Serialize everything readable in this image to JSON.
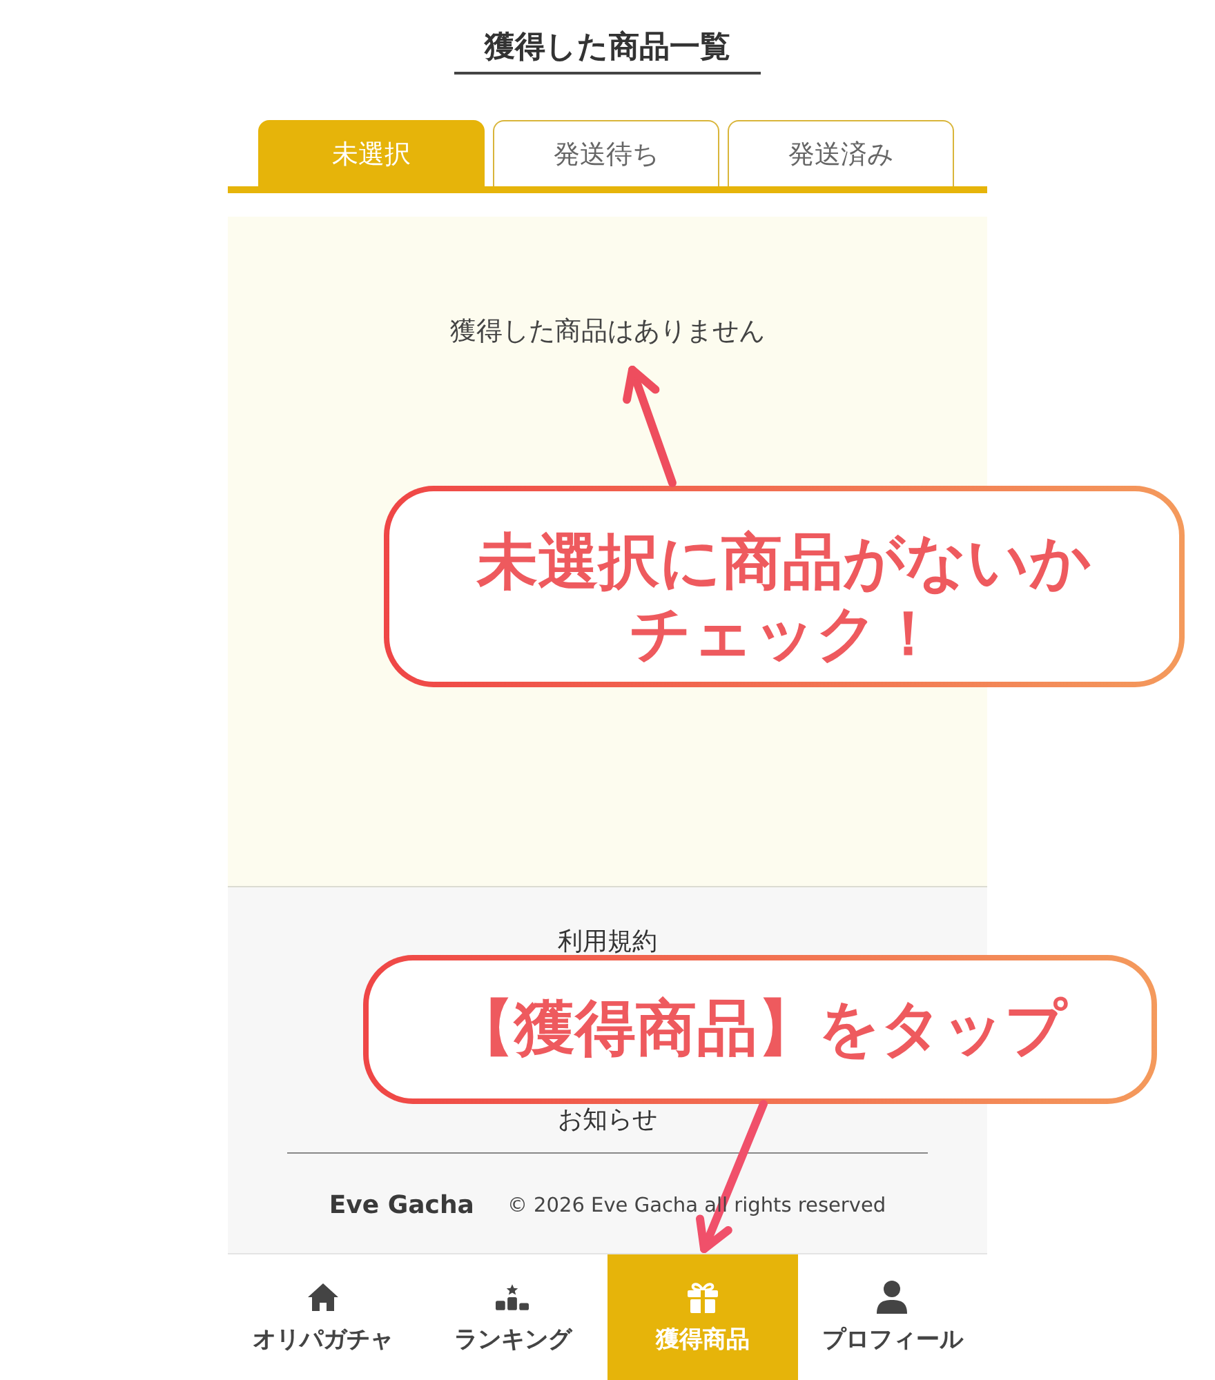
{
  "page": {
    "title": "獲得した商品一覧"
  },
  "tabs": [
    {
      "label": "未選択",
      "selected": true
    },
    {
      "label": "発送待ち",
      "selected": false
    },
    {
      "label": "発送済み",
      "selected": false
    }
  ],
  "empty_message": "獲得した商品はありません",
  "footer": {
    "links": [
      "利用規約",
      "お知らせ"
    ],
    "brand": "Eve Gacha",
    "copyright": "© 2026 Eve Gacha all rights reserved"
  },
  "bottom_nav": [
    {
      "label": "オリパガチャ",
      "selected": false
    },
    {
      "label": "ランキング",
      "selected": false
    },
    {
      "label": "獲得商品",
      "selected": true
    },
    {
      "label": "プロフィール",
      "selected": false
    }
  ],
  "annotations": [
    {
      "text": "未選択に商品がないかチェック！"
    },
    {
      "text": "【獲得商品】をタップ"
    }
  ]
}
